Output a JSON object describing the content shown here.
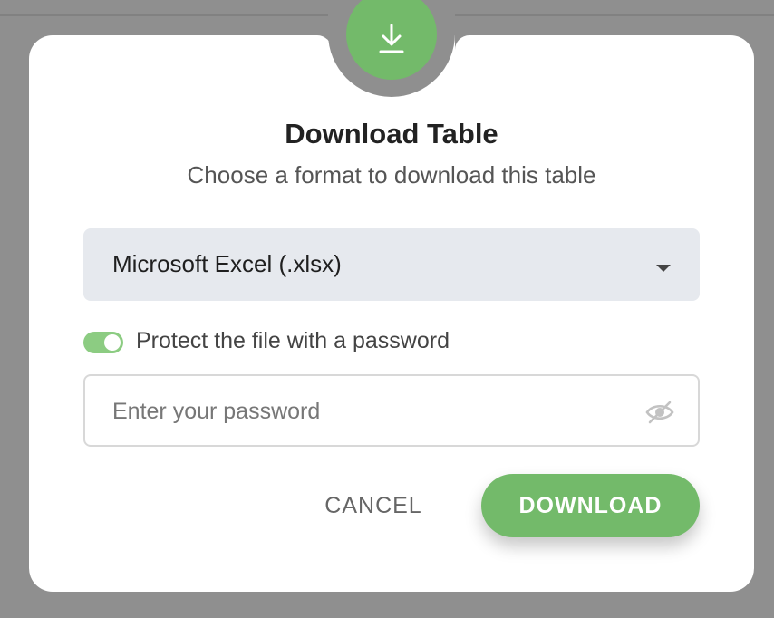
{
  "dialog": {
    "title": "Download Table",
    "subtitle": "Choose a format to download this table",
    "icon": "download-icon"
  },
  "format_select": {
    "value": "Microsoft Excel (.xlsx)",
    "icon": "chevron-down-icon"
  },
  "password_toggle": {
    "label": "Protect the file with a password",
    "enabled": true
  },
  "password_field": {
    "value": "",
    "placeholder": "Enter your password",
    "icon": "eye-off-icon"
  },
  "actions": {
    "cancel_label": "CANCEL",
    "download_label": "DOWNLOAD"
  },
  "colors": {
    "accent": "#73ba6a",
    "toggle_on": "#8ccc82",
    "backdrop": "#8f8f8f",
    "select_bg": "#e6e9ee"
  }
}
